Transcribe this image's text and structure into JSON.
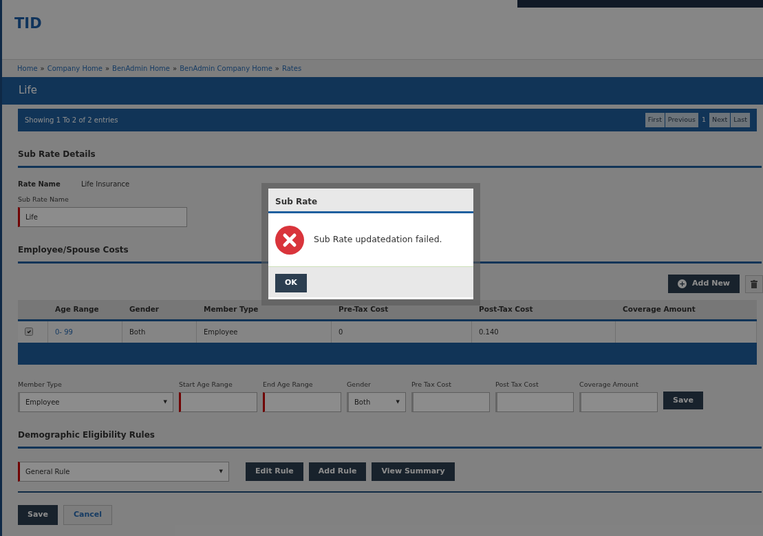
{
  "logo": "TID",
  "breadcrumb": [
    "Home",
    "Company Home",
    "BenAdmin Home",
    "BenAdmin Company Home",
    "Rates"
  ],
  "breadcrumb_separator": "»",
  "page_title": "Life",
  "pagination": {
    "summary": "Showing 1 To 2 of 2 entries",
    "buttons": [
      {
        "label": "First",
        "selected": false
      },
      {
        "label": "Previous",
        "selected": false
      },
      {
        "label": "1",
        "selected": true
      },
      {
        "label": "Next",
        "selected": false
      },
      {
        "label": "Last",
        "selected": false
      }
    ]
  },
  "sub_rate_details": {
    "heading": "Sub Rate Details",
    "rate_name_label": "Rate Name",
    "rate_name_value": "Life Insurance",
    "sub_rate_name_label": "Sub Rate Name",
    "sub_rate_name_value": "Life"
  },
  "costs": {
    "heading": "Employee/Spouse Costs",
    "add_button": "Add New",
    "add_icon": "+",
    "table": {
      "columns": [
        "Age Range",
        "Gender",
        "Member Type",
        "Pre-Tax Cost",
        "Post-Tax Cost",
        "Coverage Amount"
      ],
      "rows": [
        {
          "checked": true,
          "cells": [
            "0- 99",
            "Both",
            "Employee",
            "0",
            "0.140",
            ""
          ]
        }
      ]
    }
  },
  "entry_form": {
    "fields": [
      {
        "label": "Member Type",
        "kind": "select",
        "value": "Employee",
        "caret": "▼",
        "required": false
      },
      {
        "label": "Start Age Range",
        "kind": "text",
        "required": true
      },
      {
        "label": "End Age Range",
        "kind": "text",
        "required": true
      },
      {
        "label": "Gender",
        "kind": "select",
        "value": "Both",
        "caret": "▼",
        "required": false
      },
      {
        "label": "Pre Tax Cost",
        "kind": "text",
        "required": false
      },
      {
        "label": "Post Tax Cost",
        "kind": "text",
        "required": false
      },
      {
        "label": "Coverage Amount",
        "kind": "text",
        "required": false
      }
    ],
    "save_button": "Save"
  },
  "eligibility": {
    "heading": "Demographic Eligibility Rules",
    "rule_select": "General Rule",
    "rule_caret": "▼",
    "buttons": [
      "Edit Rule",
      "Add Rule",
      "View Summary"
    ]
  },
  "footer_buttons": [
    {
      "label": "Save",
      "kind": "primary"
    },
    {
      "label": "Cancel",
      "kind": "secondary"
    }
  ],
  "dialog": {
    "title": "Sub Rate",
    "message": "Sub Rate updatedation failed.",
    "button": "OK"
  }
}
